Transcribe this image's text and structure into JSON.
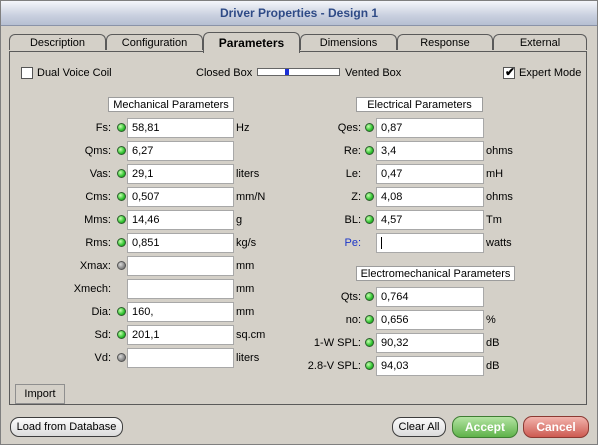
{
  "window": {
    "title": "Driver Properties - Design 1"
  },
  "tabs": [
    {
      "label": "Description"
    },
    {
      "label": "Configuration"
    },
    {
      "label": "Parameters"
    },
    {
      "label": "Dimensions"
    },
    {
      "label": "Response"
    },
    {
      "label": "External"
    }
  ],
  "options": {
    "dual_voice_coil_label": "Dual Voice Coil",
    "dual_voice_coil_checked": false,
    "closed_box_label": "Closed Box",
    "vented_box_label": "Vented Box",
    "box_slider_fraction": 0.35,
    "expert_mode_label": "Expert Mode",
    "expert_mode_checked": true,
    "check_mark": "✔"
  },
  "mechanical": {
    "title": "Mechanical Parameters",
    "rows": [
      {
        "label": "Fs:",
        "value": "58,81",
        "unit": "Hz",
        "status": "green"
      },
      {
        "label": "Qms:",
        "value": "6,27",
        "unit": "",
        "status": "green"
      },
      {
        "label": "Vas:",
        "value": "29,1",
        "unit": "liters",
        "status": "green"
      },
      {
        "label": "Cms:",
        "value": "0,507",
        "unit": "mm/N",
        "status": "green"
      },
      {
        "label": "Mms:",
        "value": "14,46",
        "unit": "g",
        "status": "green"
      },
      {
        "label": "Rms:",
        "value": "0,851",
        "unit": "kg/s",
        "status": "green"
      },
      {
        "label": "Xmax:",
        "value": "",
        "unit": "mm",
        "status": "gray"
      },
      {
        "label": "Xmech:",
        "value": "",
        "unit": "mm",
        "status": "none"
      },
      {
        "label": "Dia:",
        "value": "160,",
        "unit": "mm",
        "status": "green"
      },
      {
        "label": "Sd:",
        "value": "201,1",
        "unit": "sq.cm",
        "status": "green"
      },
      {
        "label": "Vd:",
        "value": "",
        "unit": "liters",
        "status": "gray"
      }
    ]
  },
  "electrical": {
    "title": "Electrical Parameters",
    "rows": [
      {
        "label": "Qes:",
        "value": "0,87",
        "unit": "",
        "status": "green"
      },
      {
        "label": "Re:",
        "value": "3,4",
        "unit": "ohms",
        "status": "green"
      },
      {
        "label": "Le:",
        "value": "0,47",
        "unit": "mH",
        "status": "none"
      },
      {
        "label": "Z:",
        "value": "4,08",
        "unit": "ohms",
        "status": "green"
      },
      {
        "label": "BL:",
        "value": "4,57",
        "unit": "Tm",
        "status": "green"
      },
      {
        "label": "Pe:",
        "value": "",
        "unit": "watts",
        "status": "none",
        "highlight": true
      }
    ]
  },
  "electromechanical": {
    "title": "Electromechanical Parameters",
    "rows": [
      {
        "label": "Qts:",
        "value": "0,764",
        "unit": "",
        "status": "green"
      },
      {
        "label": "no:",
        "value": "0,656",
        "unit": "%",
        "status": "green"
      },
      {
        "label": "1-W SPL:",
        "value": "90,32",
        "unit": "dB",
        "status": "green"
      },
      {
        "label": "2.8-V SPL:",
        "value": "94,03",
        "unit": "dB",
        "status": "green"
      }
    ]
  },
  "buttons": {
    "import": "Import",
    "load_from_database": "Load from Database",
    "clear_all": "Clear All",
    "accept": "Accept",
    "cancel": "Cancel"
  },
  "colors": {
    "title_text": "#2e4a86",
    "status_green": "#2fc22f",
    "status_gray": "#8a8a8a",
    "highlight_label": "#1a35c8",
    "accept_green": "#5fb24a",
    "cancel_red": "#cd5b52"
  }
}
